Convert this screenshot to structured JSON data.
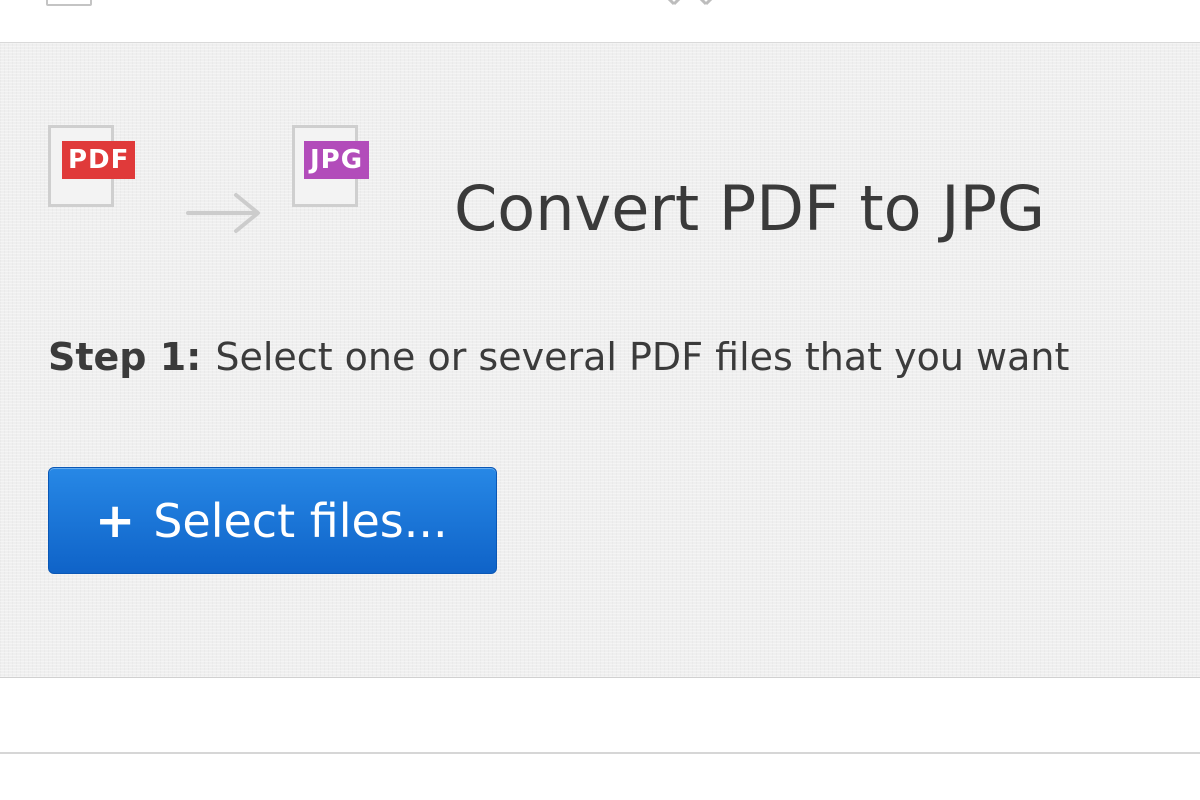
{
  "icons": {
    "source_format_label": "PDF",
    "target_format_label": "JPG",
    "source_color": "#e03a3a",
    "target_color": "#b24cba",
    "arrow_icon": "right-arrow-icon"
  },
  "header": {
    "title": "Convert PDF to JPG"
  },
  "step1": {
    "label": "Step 1:",
    "text": "Select one or several PDF files that you want"
  },
  "actions": {
    "select_files_label": "Select files...",
    "button_color": "#1a73d6",
    "plus_icon": "plus-icon"
  }
}
